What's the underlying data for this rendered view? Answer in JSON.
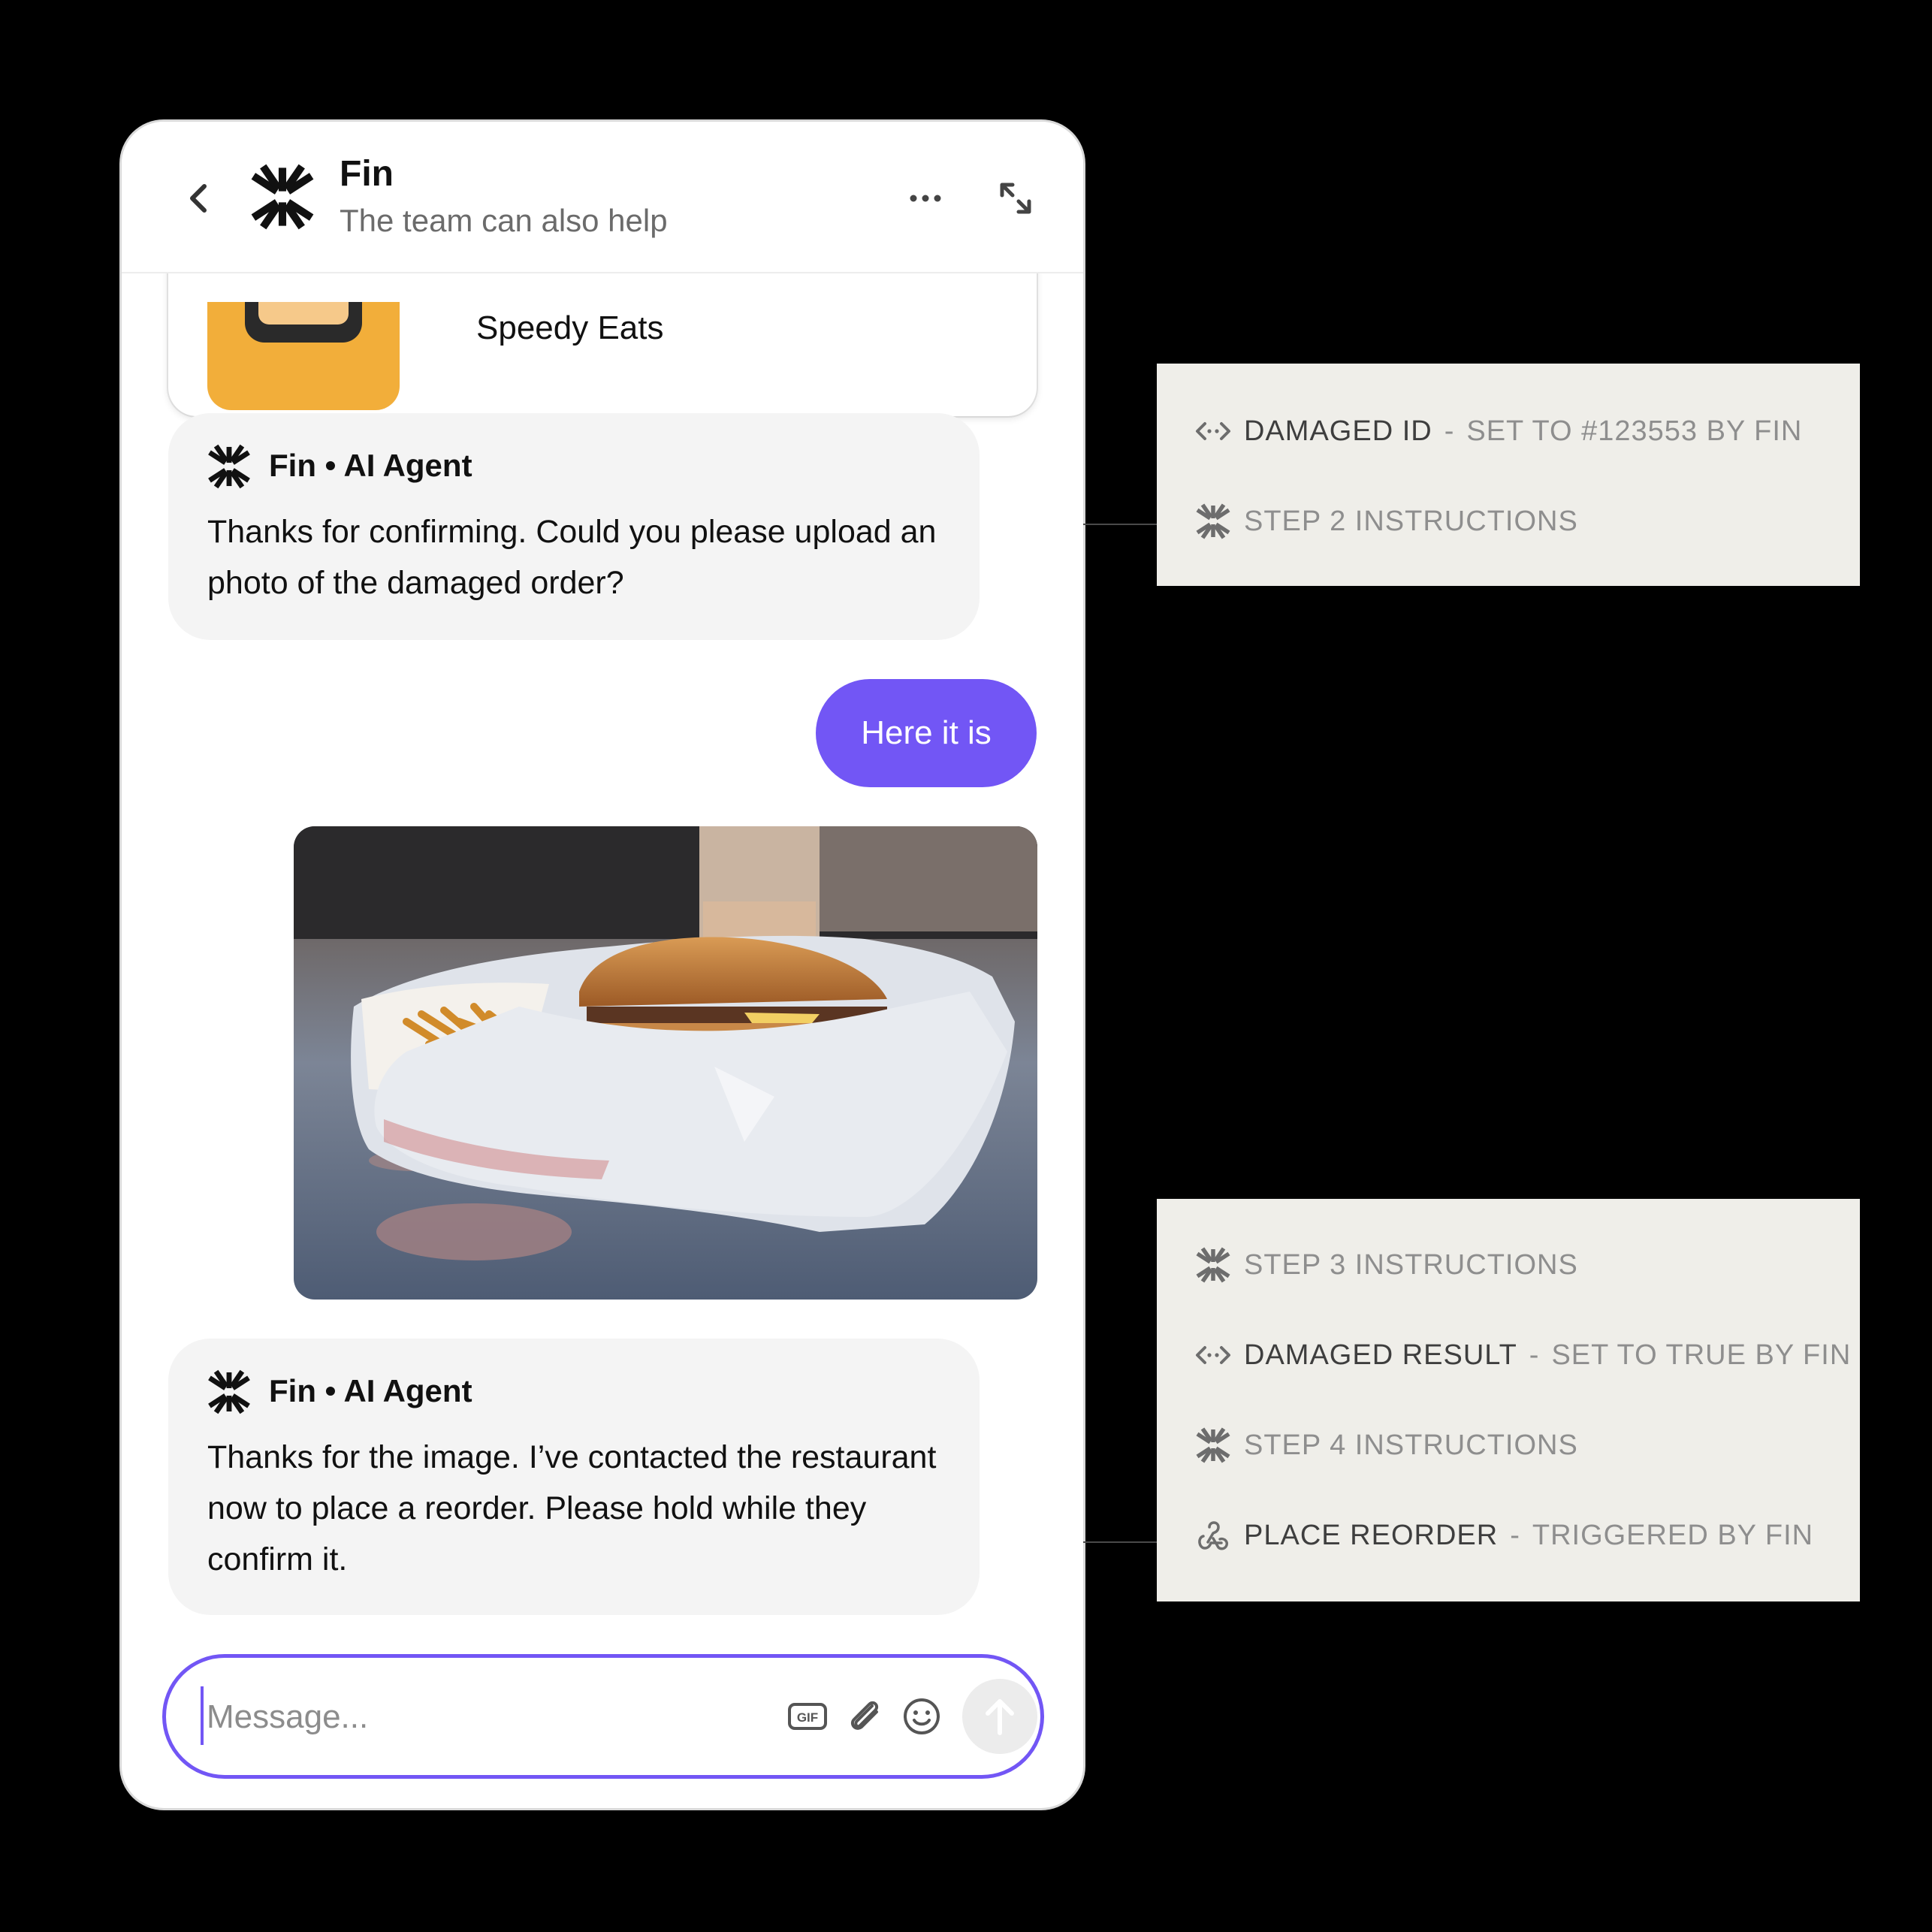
{
  "header": {
    "title": "Fin",
    "subtitle": "The team can also help"
  },
  "card": {
    "name": "Speedy Eats"
  },
  "messages": [
    {
      "sender": "Fin • AI Agent",
      "text": "Thanks for confirming. Could you please upload an photo of the damaged order?"
    },
    {
      "sender": "user",
      "text": "Here it is"
    },
    {
      "sender": "Fin • AI Agent",
      "text": "Thanks for the image. I’ve contacted the restaurant now to place a reorder. Please hold while they confirm it."
    }
  ],
  "composer": {
    "placeholder": "Message..."
  },
  "panel_top": [
    {
      "icon": "attribute-icon",
      "key": "DAMAGED ID",
      "sep": "-",
      "value": "SET TO #123553 BY FIN"
    },
    {
      "icon": "fin-icon",
      "key": "STEP 2 INSTRUCTIONS"
    }
  ],
  "panel_bottom": [
    {
      "icon": "fin-icon",
      "key": "STEP 3 INSTRUCTIONS"
    },
    {
      "icon": "attribute-icon",
      "key": "DAMAGED RESULT",
      "sep": "-",
      "value": "SET TO TRUE BY FIN"
    },
    {
      "icon": "fin-icon",
      "key": "STEP 4 INSTRUCTIONS"
    },
    {
      "icon": "webhook-icon",
      "key": "PLACE REORDER",
      "sep": "-",
      "value": "TRIGGERED BY FIN"
    }
  ],
  "colors": {
    "accent": "#7256f5",
    "panel_bg": "#efeee9",
    "bubble_bg": "#f4f4f4"
  }
}
